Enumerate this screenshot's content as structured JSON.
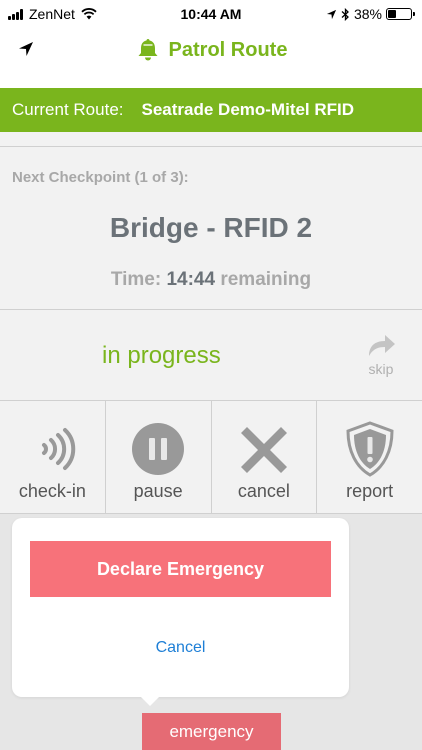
{
  "status_bar": {
    "carrier": "ZenNet",
    "time": "10:44 AM",
    "battery": "38%"
  },
  "nav": {
    "title": "Patrol Route",
    "icons": [
      "location-arrow-icon",
      "bell-icon"
    ]
  },
  "route": {
    "label": "Current Route:",
    "value": "Seatrade Demo-Mitel RFID"
  },
  "checkpoint": {
    "next_label": "Next Checkpoint (1 of 3):",
    "name": "Bridge - RFID 2",
    "time_prefix": "Time:",
    "time_value": "14:44",
    "time_suffix": "remaining"
  },
  "progress": {
    "status": "in progress",
    "skip_label": "skip"
  },
  "actions": [
    {
      "label": "check-in",
      "icon": "nfc-icon"
    },
    {
      "label": "pause",
      "icon": "pause-icon"
    },
    {
      "label": "cancel",
      "icon": "x-icon"
    },
    {
      "label": "report",
      "icon": "shield-alert-icon"
    }
  ],
  "popup": {
    "declare_label": "Declare Emergency",
    "cancel_label": "Cancel"
  },
  "emergency_tab": {
    "label": "emergency"
  },
  "colors": {
    "brand_green": "#7ab51d",
    "emergency_red": "#f7727a",
    "link_blue": "#1e7fd6"
  }
}
